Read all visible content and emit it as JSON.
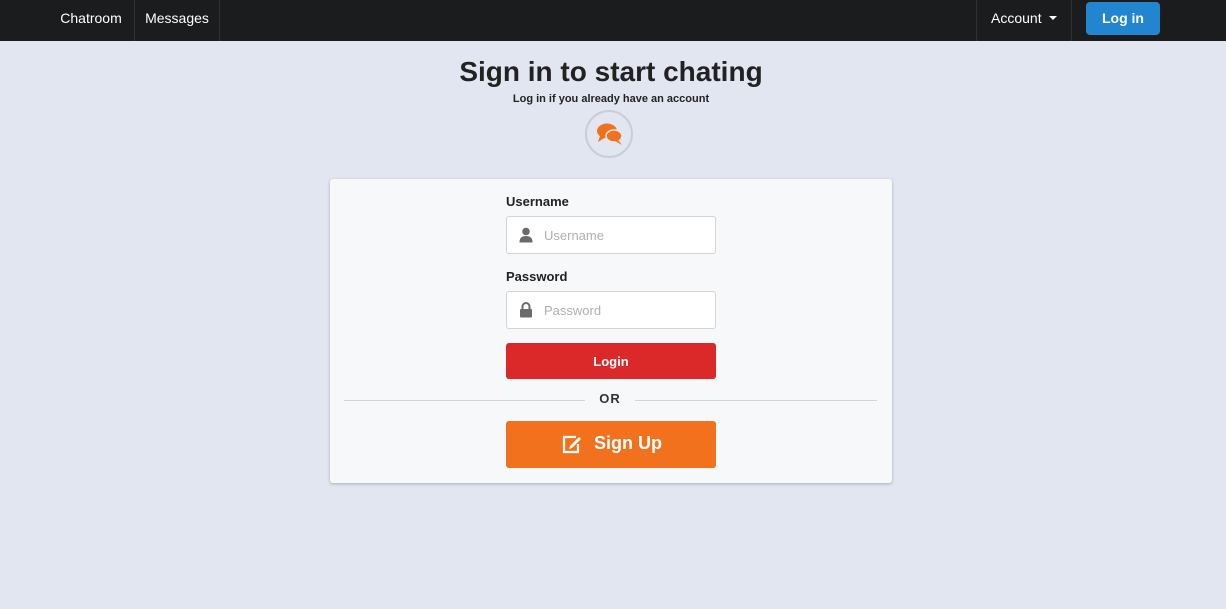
{
  "navbar": {
    "items": [
      {
        "label": "Chatroom"
      },
      {
        "label": "Messages"
      }
    ],
    "account_label": "Account",
    "login_label": "Log in"
  },
  "header": {
    "title": "Sign in to start chating",
    "subtitle": "Log in if you already have an account",
    "logo_icon": "chat-bubbles-icon"
  },
  "form": {
    "username_label": "Username",
    "username_placeholder": "Username",
    "username_value": "",
    "password_label": "Password",
    "password_placeholder": "Password",
    "password_value": "",
    "login_button": "Login",
    "divider_text": "OR",
    "signup_button": "Sign Up",
    "username_icon": "user-icon",
    "password_icon": "lock-icon",
    "signup_icon": "edit-icon"
  },
  "colors": {
    "navbar_bg": "#1b1c1d",
    "page_bg": "#e2e6f1",
    "nav_login_button": "#2185d0",
    "login_button": "#db2828",
    "signup_button": "#f2711c",
    "logo_accent": "#f2711c"
  }
}
